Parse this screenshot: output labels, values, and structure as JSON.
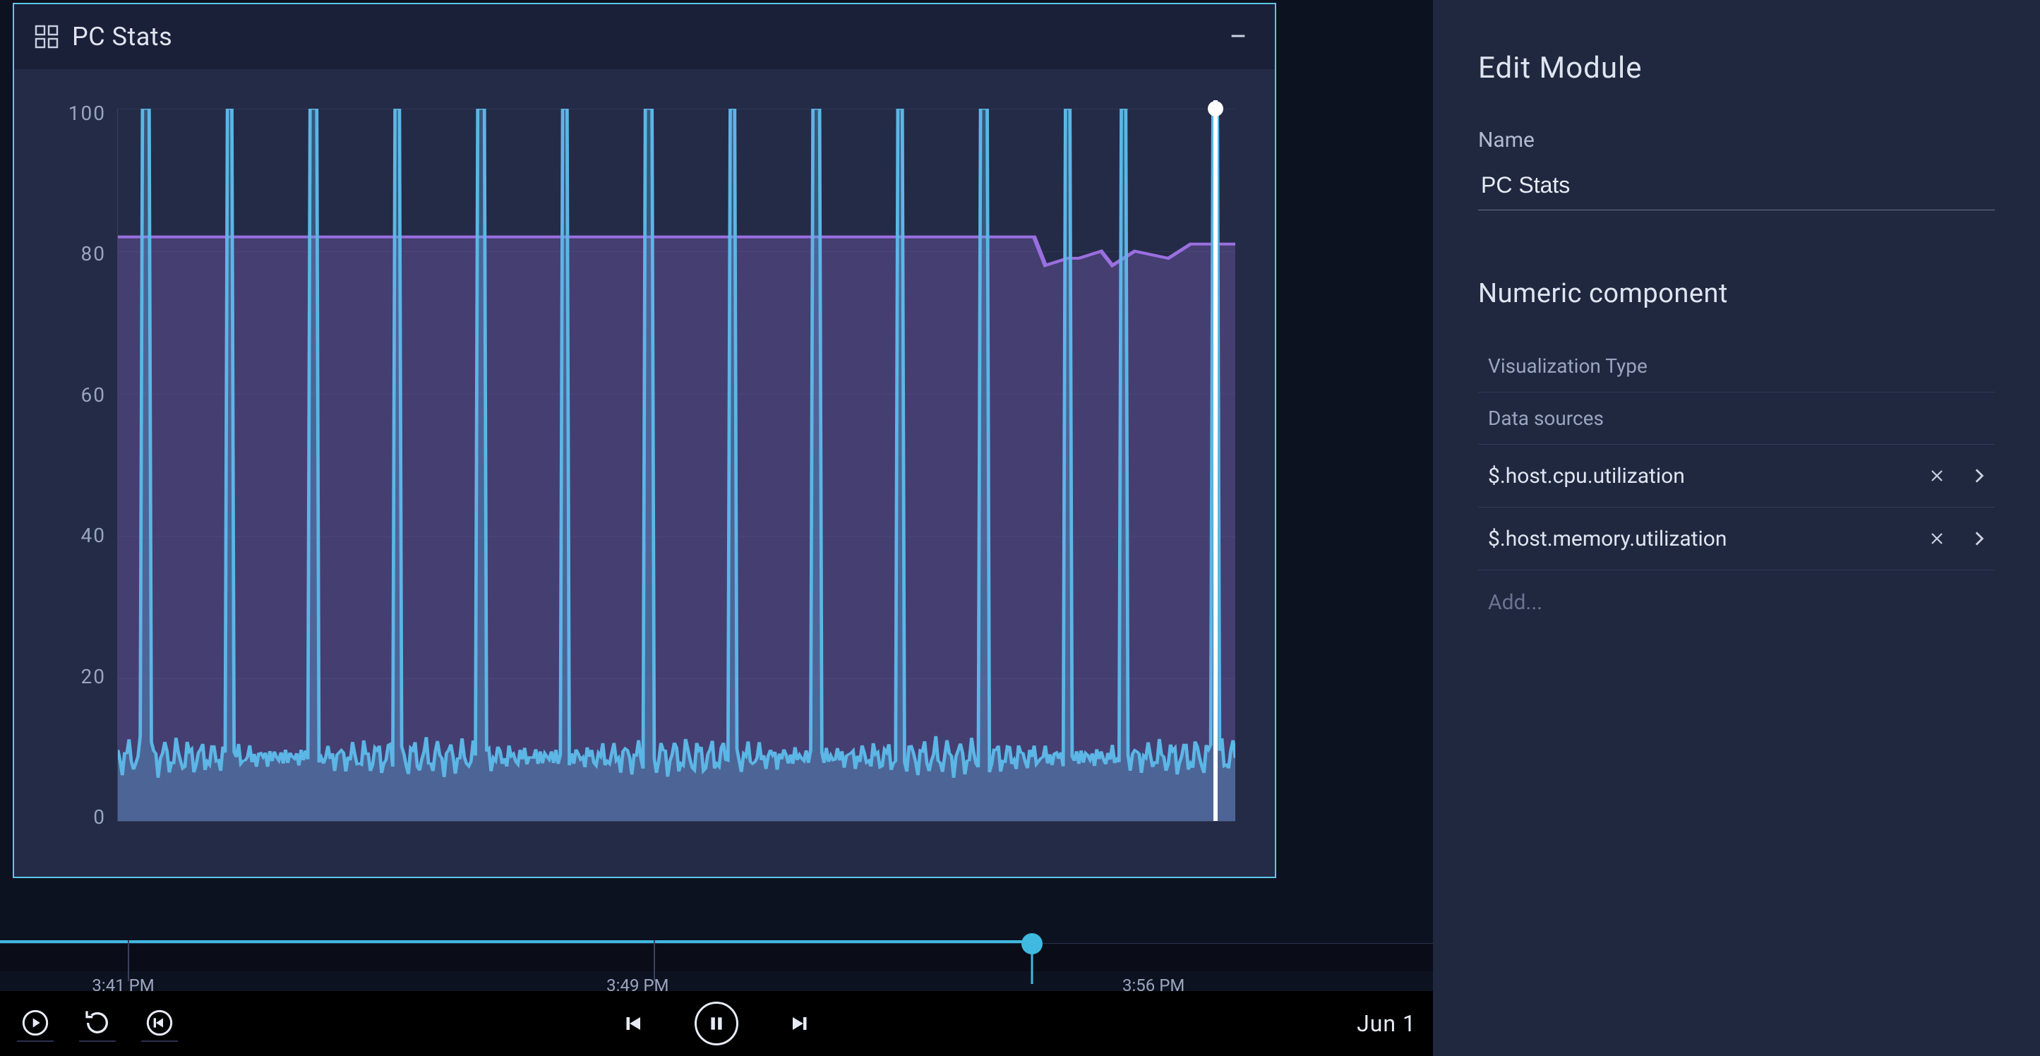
{
  "module": {
    "title": "PC Stats"
  },
  "side": {
    "heading": "Edit Module",
    "name_label": "Name",
    "name_value": "PC Stats",
    "section": "Numeric component",
    "viz_type_label": "Visualization Type",
    "data_sources_label": "Data sources",
    "sources": [
      "$.host.cpu.utilization",
      "$.host.memory.utilization"
    ],
    "add_placeholder": "Add..."
  },
  "timeline": {
    "labels": [
      "3:41 PM",
      "3:49 PM",
      "3:56 PM"
    ],
    "label_positions_pct": [
      8.6,
      44.5,
      80.5
    ],
    "playhead_pct": 72,
    "separators_pct": [
      8.9,
      45.6
    ],
    "ticks_pct": [
      [
        0.3,
        0.4
      ],
      [
        1.0,
        0.5
      ],
      [
        2.8,
        1.1
      ],
      [
        4.4,
        0.4
      ],
      [
        5.2,
        0.4
      ],
      [
        6.3,
        0.8
      ],
      [
        7.4,
        0.4
      ],
      [
        8.0,
        0.4
      ],
      [
        9.7,
        1.0
      ],
      [
        11.0,
        0.4
      ],
      [
        12.0,
        0.6
      ],
      [
        13.2,
        0.7
      ],
      [
        14.0,
        0.4
      ],
      [
        15.2,
        1.0
      ],
      [
        16.6,
        0.4
      ],
      [
        17.4,
        0.4
      ],
      [
        18.6,
        1.1
      ],
      [
        20.2,
        0.9
      ],
      [
        21.4,
        0.5
      ],
      [
        22.4,
        0.5
      ],
      [
        23.6,
        0.6
      ],
      [
        24.6,
        0.4
      ],
      [
        25.6,
        1.0
      ],
      [
        27.0,
        0.6
      ],
      [
        28.2,
        0.9
      ],
      [
        29.4,
        0.6
      ],
      [
        30.4,
        0.4
      ],
      [
        31.4,
        0.8
      ],
      [
        32.6,
        0.5
      ],
      [
        33.6,
        0.8
      ],
      [
        34.8,
        0.4
      ],
      [
        35.8,
        0.5
      ],
      [
        37.0,
        1.0
      ],
      [
        38.4,
        0.4
      ],
      [
        39.4,
        0.8
      ],
      [
        40.6,
        0.4
      ],
      [
        41.6,
        0.5
      ],
      [
        42.8,
        0.9
      ],
      [
        44.0,
        0.4
      ],
      [
        46.2,
        1.0
      ],
      [
        47.6,
        0.5
      ],
      [
        48.6,
        0.4
      ],
      [
        49.8,
        0.8
      ],
      [
        51.0,
        0.5
      ],
      [
        52.0,
        0.8
      ],
      [
        53.2,
        0.4
      ],
      [
        54.2,
        0.6
      ],
      [
        55.4,
        1.0
      ],
      [
        56.8,
        0.4
      ],
      [
        57.8,
        1.0
      ],
      [
        59.2,
        0.4
      ],
      [
        60.2,
        0.4
      ],
      [
        61.4,
        0.9
      ],
      [
        62.6,
        0.4
      ],
      [
        63.6,
        0.4
      ],
      [
        64.8,
        0.9
      ],
      [
        66.0,
        0.4
      ],
      [
        67.0,
        0.8
      ],
      [
        68.2,
        0.4
      ],
      [
        69.2,
        0.8
      ],
      [
        70.4,
        0.4
      ],
      [
        71.4,
        0.5
      ],
      [
        73.0,
        0.9
      ],
      [
        74.2,
        0.4
      ],
      [
        75.2,
        0.8
      ],
      [
        76.4,
        0.4
      ],
      [
        77.4,
        0.6
      ],
      [
        78.6,
        0.9
      ],
      [
        79.8,
        0.4
      ],
      [
        80.8,
        0.4
      ],
      [
        82.0,
        0.8
      ],
      [
        83.2,
        0.4
      ],
      [
        84.2,
        0.9
      ],
      [
        85.6,
        0.4
      ],
      [
        86.6,
        0.4
      ],
      [
        87.8,
        0.8
      ],
      [
        89.0,
        0.4
      ],
      [
        90.0,
        0.4
      ],
      [
        91.2,
        0.8
      ],
      [
        92.4,
        0.4
      ],
      [
        93.4,
        0.8
      ],
      [
        94.6,
        0.4
      ],
      [
        95.6,
        0.4
      ],
      [
        96.8,
        0.8
      ],
      [
        98.0,
        0.4
      ],
      [
        99.0,
        0.4
      ]
    ]
  },
  "playbar": {
    "date": "Jun 1"
  },
  "chart_data": {
    "type": "line",
    "ylim": [
      0,
      100
    ],
    "y_ticks": [
      100,
      80,
      60,
      40,
      20,
      0
    ],
    "x_range_minutes": [
      0,
      15
    ],
    "cursor_x_pct": 98.2,
    "series": [
      {
        "name": "$.host.memory.utilization",
        "color": "#9a6fe0",
        "fill": "rgba(154,111,224,0.28)",
        "data_pct": [
          [
            0,
            82
          ],
          [
            4,
            82
          ],
          [
            8,
            82
          ],
          [
            12,
            82
          ],
          [
            16,
            82
          ],
          [
            20,
            82
          ],
          [
            24,
            82
          ],
          [
            28,
            82
          ],
          [
            32,
            82
          ],
          [
            36,
            82
          ],
          [
            40,
            82
          ],
          [
            44,
            82
          ],
          [
            48,
            82
          ],
          [
            52,
            82
          ],
          [
            56,
            82
          ],
          [
            60,
            82
          ],
          [
            64,
            82
          ],
          [
            68,
            82
          ],
          [
            72,
            82
          ],
          [
            76,
            82
          ],
          [
            80,
            82
          ],
          [
            82,
            82
          ],
          [
            83,
            78
          ],
          [
            85,
            79
          ],
          [
            86,
            79
          ],
          [
            88,
            80
          ],
          [
            89,
            78
          ],
          [
            91,
            80
          ],
          [
            94,
            79
          ],
          [
            96,
            81
          ],
          [
            98,
            81
          ],
          [
            100,
            81
          ]
        ]
      },
      {
        "name": "$.host.cpu.utilization",
        "color": "#5cb6e6",
        "fill": "rgba(92,182,230,0.32)",
        "baseline": 7,
        "noise": 3,
        "spikes_x_pct": [
          2.5,
          10,
          17.5,
          25,
          32.5,
          40,
          47.5,
          55,
          62.5,
          70,
          77.5,
          85,
          90,
          98.2
        ],
        "spike_value": 100
      }
    ]
  }
}
